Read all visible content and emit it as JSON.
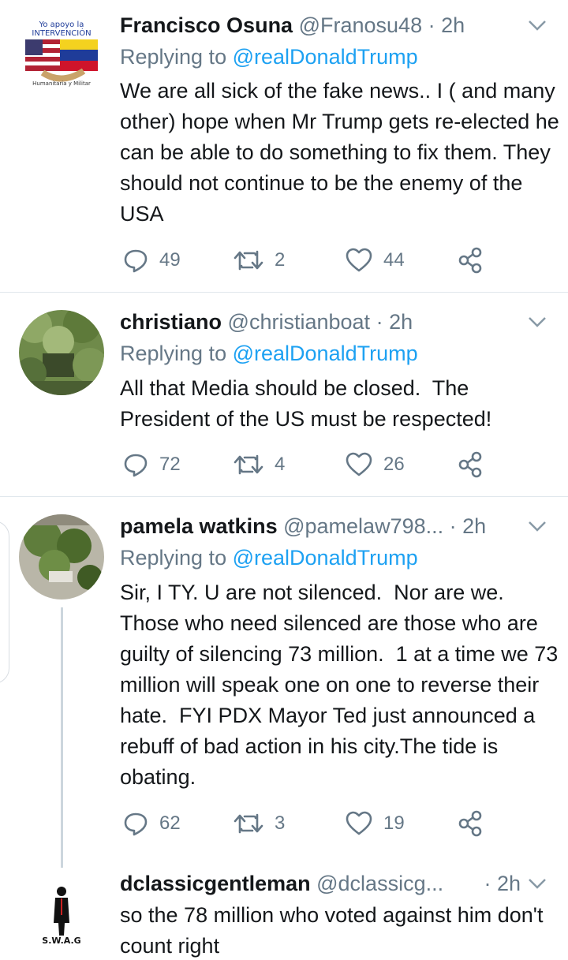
{
  "tweets": [
    {
      "name": "Francisco Osuna",
      "handle": "@Franosu48",
      "dot": "·",
      "time": "2h",
      "replying_prefix": "Replying to",
      "replying_to": "@realDonaldTrump",
      "text": "We are all sick of the fake news.. I ( and many other) hope when Mr Trump gets re-elected he can be able to do something to fix them. They should not continue to be the enemy of the USA",
      "replies": "49",
      "retweets": "2",
      "likes": "44",
      "avatar_text": [
        "Yo apoyo la",
        "INTERVENCIÓN",
        "Humanitaria y Militar"
      ]
    },
    {
      "name": "christiano",
      "handle": "@christianboat",
      "dot": "·",
      "time": "2h",
      "replying_prefix": "Replying to",
      "replying_to": "@realDonaldTrump",
      "text": "All that Media should be closed.  The President of the US must be respected!",
      "replies": "72",
      "retweets": "4",
      "likes": "26"
    },
    {
      "name": "pamela watkins",
      "handle": "@pamelaw798...",
      "dot": "·",
      "time": "2h",
      "replying_prefix": "Replying to",
      "replying_to": "@realDonaldTrump",
      "text": "Sir, I TY. U are not silenced.  Nor are we.  Those who need silenced are those who are guilty of silencing 73 million.  1 at a time we 73 million will speak one on one to reverse their hate.  FYI PDX Mayor Ted just announced a rebuff of bad action in his city.The tide is obating.",
      "replies": "62",
      "retweets": "3",
      "likes": "19"
    },
    {
      "name": "dclassicgentleman",
      "handle": "@dclassicg...",
      "dot": "·",
      "time": "2h",
      "text": "so the 78 million who voted against him don't count right",
      "avatar_text": "S.W.A.G"
    }
  ],
  "colors": {
    "link": "#1da1f2",
    "secondary": "#657786",
    "primary_text": "#14171a",
    "divider": "#e1e8ed"
  },
  "icons": [
    "reply-icon",
    "retweet-icon",
    "like-icon",
    "share-icon",
    "chevron-down-icon"
  ]
}
